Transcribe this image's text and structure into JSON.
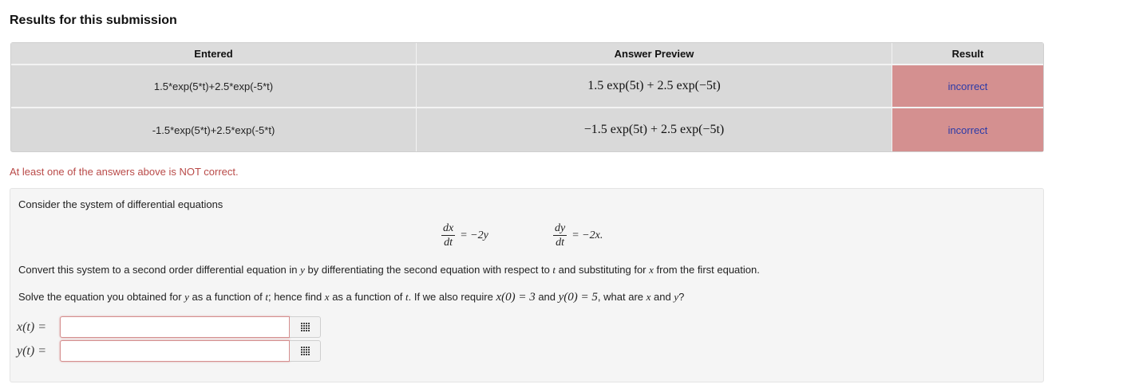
{
  "heading": "Results for this submission",
  "table": {
    "headers": {
      "entered": "Entered",
      "preview": "Answer Preview",
      "result": "Result"
    },
    "rows": [
      {
        "entered": "1.5*exp(5*t)+2.5*exp(-5*t)",
        "preview": "1.5 exp(5t) + 2.5 exp(−5t)",
        "result": "incorrect"
      },
      {
        "entered": "-1.5*exp(5*t)+2.5*exp(-5*t)",
        "preview": "−1.5 exp(5t) + 2.5 exp(−5t)",
        "result": "incorrect"
      }
    ]
  },
  "warning": "At least one of the answers above is NOT correct.",
  "problem": {
    "intro": "Consider the system of differential equations",
    "eq1": {
      "num": "dx",
      "den": "dt",
      "rhs": "= −2y"
    },
    "eq2": {
      "num": "dy",
      "den": "dt",
      "rhs": "= −2x."
    },
    "para1": {
      "t1": "Convert this system to a second order differential equation in ",
      "m1": "y",
      "t2": " by differentiating the second equation with respect to ",
      "m2": "t",
      "t3": " and substituting for ",
      "m3": "x",
      "t4": " from the first equation."
    },
    "para2": {
      "t1": "Solve the equation you obtained for ",
      "m1": "y",
      "t2": " as a function of ",
      "m2": "t",
      "t3": "; hence find ",
      "m3": "x",
      "t4": " as a function of ",
      "m4": "t",
      "t5": ". If we also require ",
      "m5": "x(0) = 3",
      "t6": " and ",
      "m6": "y(0) = 5",
      "t7": ", what are ",
      "m7": "x",
      "t8": " and ",
      "m8": "y",
      "t9": "?"
    },
    "answers": [
      {
        "label": "x(t) =",
        "value": "",
        "placeholder": ""
      },
      {
        "label": "y(t) =",
        "value": "",
        "placeholder": ""
      }
    ],
    "grid_icon": "equation-editor-grid-icon"
  },
  "colors": {
    "incorrect_bg": "#d49090",
    "result_text": "#2b3aa8",
    "warning_text": "#b94a48"
  }
}
